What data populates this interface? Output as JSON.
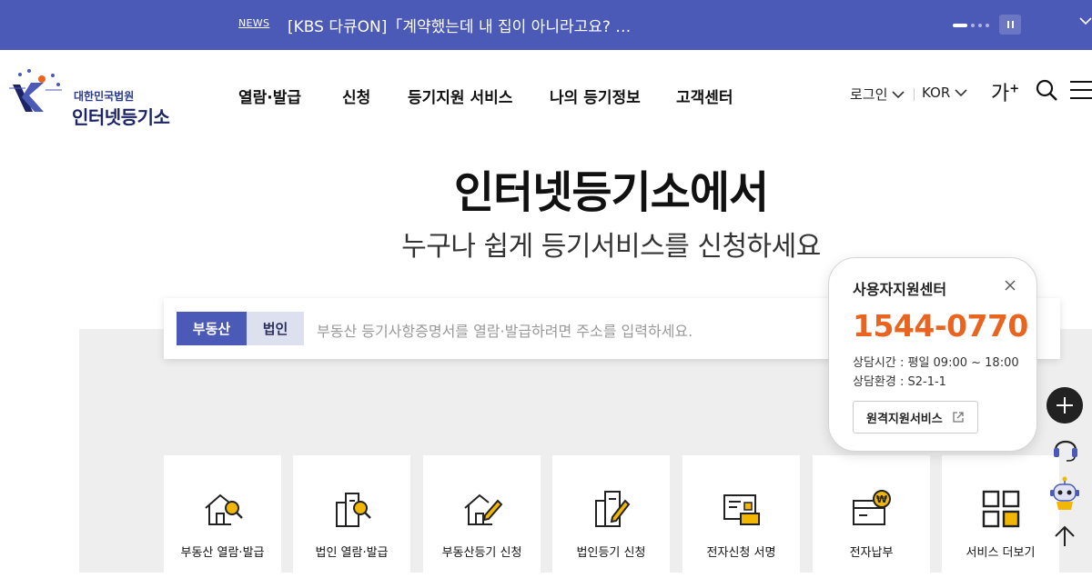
{
  "news": {
    "label": "NEWS",
    "headline": "[KBS 다큐ON]「계약했는데 내 집이 아니라고요? …",
    "pause_icon": "pause-icon",
    "expand_icon": "chevron-down-icon"
  },
  "header": {
    "logo_sub": "대한민국법원",
    "logo_main": "인터넷등기소",
    "nav": [
      "열람·발급",
      "신청",
      "등기지원 서비스",
      "나의 등기정보",
      "고객센터"
    ],
    "login": "로그인",
    "language": "KOR",
    "font_size": "가",
    "font_size_plus": "+"
  },
  "hero": {
    "title": "인터넷등기소에서",
    "subtitle": "누구나 쉽게 등기서비스를 신청하세요"
  },
  "search": {
    "tabs": [
      "부동산",
      "법인"
    ],
    "active_tab": "부동산",
    "placeholder": "부동산 등기사항증명서를 열람·발급하려면 주소를 입력하세요."
  },
  "services": [
    {
      "label": "부동산 열람·발급",
      "icon": "house-search-icon"
    },
    {
      "label": "법인 열람·발급",
      "icon": "building-search-icon"
    },
    {
      "label": "부동산등기 신청",
      "icon": "house-pen-icon"
    },
    {
      "label": "법인등기 신청",
      "icon": "document-pen-icon"
    },
    {
      "label": "전자신청 서명",
      "icon": "e-sign-icon"
    },
    {
      "label": "전자납부",
      "icon": "wallet-won-icon"
    },
    {
      "label": "서비스 더보기",
      "icon": "grid-more-icon"
    }
  ],
  "support": {
    "title": "사용자지원센터",
    "phone": "1544-0770",
    "hours": "상담시간 : 평일 09:00 ~ 18:00",
    "environment": "상담환경 : S2-1-1",
    "remote_button": "원격지원서비스"
  },
  "colors": {
    "brand_blue": "#4c5ab7",
    "phone_orange": "#e8641f",
    "icon_yellow": "#f2b705"
  }
}
